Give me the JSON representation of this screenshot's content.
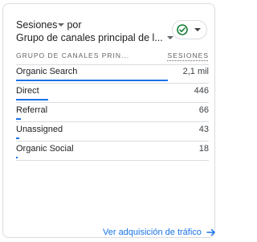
{
  "card": {
    "metric_label": "Sesiones",
    "by_label": "por",
    "dimension_label": "Grupo de canales principal de l...",
    "col_dimension": "GRUPO DE CANALES PRIN...",
    "col_metric": "SESIONES",
    "rows": [
      {
        "name": "Organic Search",
        "value": "2,1 mil",
        "share": 1.0
      },
      {
        "name": "Direct",
        "value": "446",
        "share": 0.212
      },
      {
        "name": "Referral",
        "value": "66",
        "share": 0.031
      },
      {
        "name": "Unassigned",
        "value": "43",
        "share": 0.02
      },
      {
        "name": "Organic Social",
        "value": "18",
        "share": 0.009
      }
    ],
    "footer_link": "Ver adquisición de tráfico"
  },
  "colors": {
    "accent": "#1a73e8",
    "check": "#188038",
    "border": "#dadce0"
  },
  "icons": {
    "status": "check-circle-icon",
    "dropdown": "chevron-down-icon",
    "footer": "arrow-right-icon"
  }
}
